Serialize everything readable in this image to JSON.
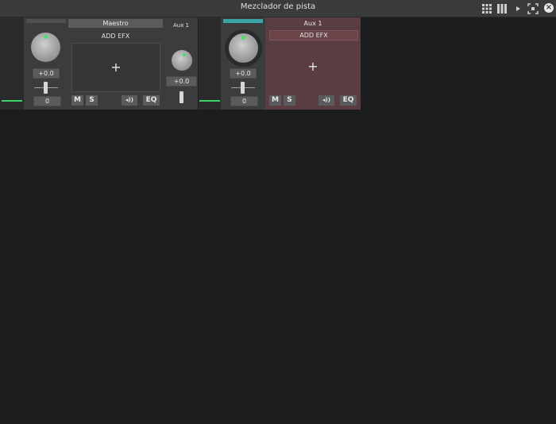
{
  "window": {
    "title": "Mezclador de pista"
  },
  "master": {
    "name": "Maestro",
    "pan_value": "+0.0",
    "volume_value": "0",
    "add_efx": "ADD EFX",
    "plus": "+",
    "mute": "M",
    "solo": "S",
    "phase": "◂))",
    "eq": "EQ",
    "aux_send": {
      "label": "Aux 1",
      "value": "+0.0"
    }
  },
  "aux1": {
    "name": "Aux 1",
    "pan_value": "+0.0",
    "volume_value": "0",
    "add_efx": "ADD EFX",
    "plus": "+",
    "mute": "M",
    "solo": "S",
    "phase": "◂))",
    "eq": "EQ"
  },
  "colors": {
    "background": "#1c1d1f",
    "strip": "#3b3c3e",
    "aux_strip_tint": "#5a3d40",
    "meter_green": "#3ad36a",
    "teal_header": "#3aa5a5"
  },
  "icons": {
    "layout_grid": "grid-icon",
    "layout_columns": "columns-icon",
    "play": "play-icon",
    "fit": "fit-icon",
    "close": "close-icon"
  }
}
